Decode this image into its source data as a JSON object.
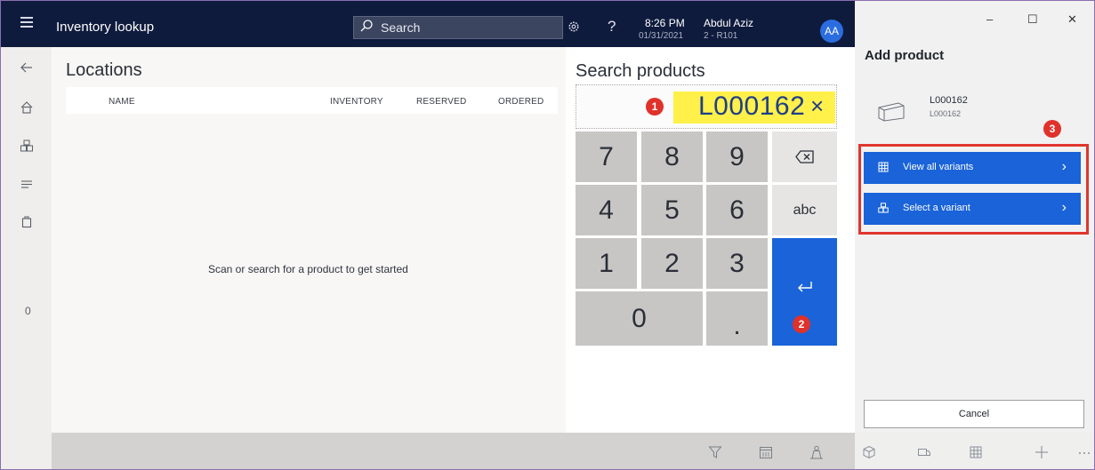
{
  "topbar": {
    "menu_icon": "hamburger-icon",
    "title": "Inventory lookup",
    "search_label": "Search",
    "settings_icon": "gear-icon",
    "help_label": "?",
    "time": "8:26 PM",
    "date": "01/31/2021",
    "user_name": "Abdul Aziz",
    "register": "2 - R101",
    "avatar_initials": "AA",
    "bar_color": "#0f1b3d",
    "avatar_color": "#2b6de0"
  },
  "sidebar": {
    "items": [
      "back-arrow-icon",
      "home-icon",
      "products-icon",
      "list-icon",
      "bag-icon"
    ],
    "count": "0"
  },
  "locations": {
    "title": "Locations",
    "columns": [
      "NAME",
      "INVENTORY",
      "RESERVED",
      "ORDERED"
    ],
    "empty_message": "Scan or search for a product to get started"
  },
  "numpad": {
    "label": "Search products",
    "entry_value": "L000162",
    "clear_label": "×",
    "keys": [
      "7",
      "8",
      "9",
      "4",
      "5",
      "6",
      "1",
      "2",
      "3",
      "0",
      "."
    ],
    "backspace_icon": "backspace-icon",
    "abc_label": "abc",
    "enter_icon": "enter-icon",
    "highlight_color": "#fff04a",
    "enter_color": "#1a63d9"
  },
  "callouts": {
    "one": "1",
    "two": "2",
    "three": "3",
    "color": "#e0312b"
  },
  "add_product": {
    "title": "Add product",
    "product_name": "L000162",
    "product_id": "L000162",
    "view_all_label": "View all variants",
    "select_variant_label": "Select a variant",
    "cancel_label": "Cancel",
    "window_minimize": "–",
    "window_maximize": "☐",
    "window_close": "✕",
    "button_color": "#1a63d9"
  },
  "bottom_toolbar": {
    "icons": [
      "filter-icon",
      "calendar-icon",
      "person-icon",
      "box-icon",
      "truck-icon",
      "grid-icon",
      "plus-icon",
      "more-icon"
    ]
  }
}
